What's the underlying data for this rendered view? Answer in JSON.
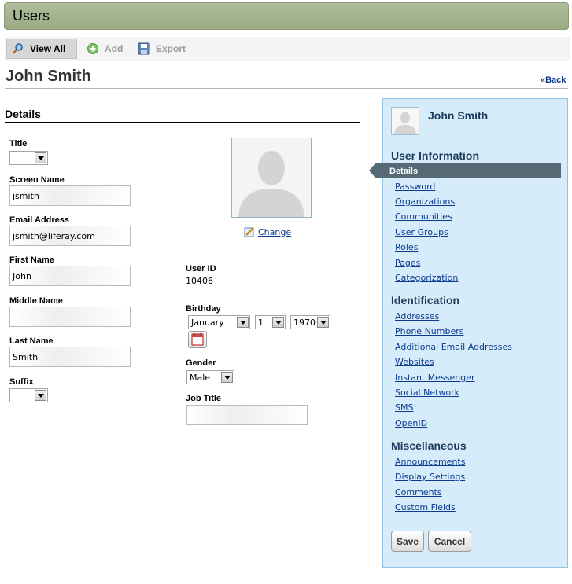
{
  "portlet": {
    "title": "Users"
  },
  "toolbar": {
    "view_all": "View All",
    "add": "Add",
    "export": "Export"
  },
  "page": {
    "heading": "John Smith",
    "back_link": "«Back"
  },
  "details": {
    "section_title": "Details",
    "title_label": "Title",
    "title_value": "",
    "screen_name_label": "Screen Name",
    "screen_name_value": "jsmith",
    "email_label": "Email Address",
    "email_value": "jsmith@liferay.com",
    "first_name_label": "First Name",
    "first_name_value": "John",
    "middle_name_label": "Middle Name",
    "middle_name_value": "",
    "last_name_label": "Last Name",
    "last_name_value": "Smith",
    "suffix_label": "Suffix",
    "suffix_value": "",
    "change_link": "Change",
    "user_id_label": "User ID",
    "user_id_value": "10406",
    "birthday_label": "Birthday",
    "birthday_month": "January",
    "birthday_day": "1",
    "birthday_year": "1970",
    "gender_label": "Gender",
    "gender_value": "Male",
    "job_title_label": "Job Title",
    "job_title_value": ""
  },
  "sidebar": {
    "name": "John Smith",
    "user_information": {
      "heading": "User Information",
      "active": "Details",
      "links": [
        "Password",
        "Organizations",
        "Communities",
        "User Groups",
        "Roles",
        "Pages",
        "Categorization"
      ]
    },
    "identification": {
      "heading": "Identification",
      "links": [
        "Addresses",
        "Phone Numbers",
        "Additional Email Addresses",
        "Websites",
        "Instant Messenger",
        "Social Network",
        "SMS",
        "OpenID"
      ]
    },
    "miscellaneous": {
      "heading": "Miscellaneous",
      "links": [
        "Announcements",
        "Display Settings",
        "Comments",
        "Custom Fields"
      ]
    },
    "save_button": "Save",
    "cancel_button": "Cancel"
  },
  "colors": {
    "title_bar": "#9aab84",
    "sidebar_bg": "#d6ecfb",
    "link": "#0b3a8f",
    "active_item": "#566a76"
  }
}
